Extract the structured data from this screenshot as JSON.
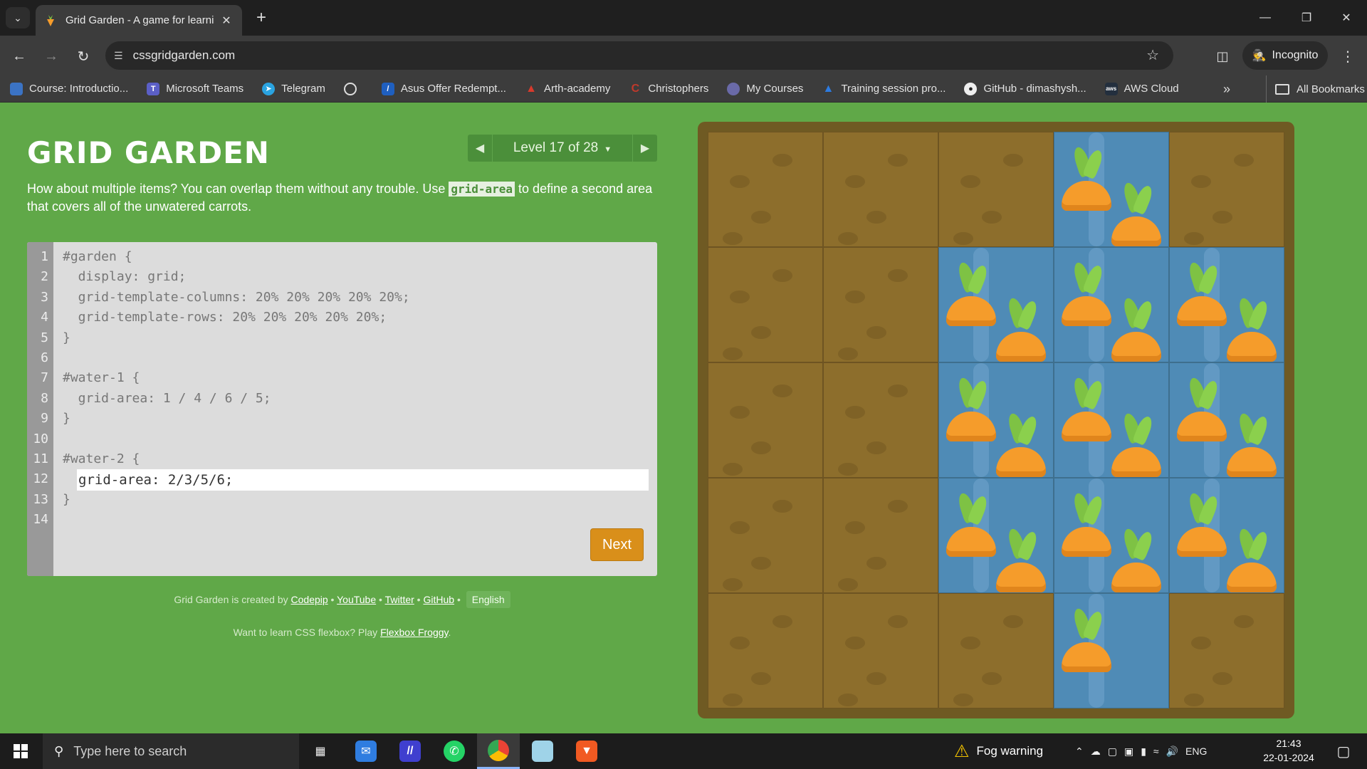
{
  "browser": {
    "tab_title": "Grid Garden - A game for learni",
    "url": "cssgridgarden.com",
    "incognito_label": "Incognito",
    "bookmarks": [
      {
        "label": "Course: Introductio...",
        "color": "#3b73c4"
      },
      {
        "label": "Microsoft Teams",
        "color": "#5b5fc7"
      },
      {
        "label": "Telegram",
        "color": "#2aa3e0"
      },
      {
        "label": "",
        "color": "#555555"
      },
      {
        "label": "Asus Offer Redempt...",
        "color": "#1f5fbf"
      },
      {
        "label": "Arth-academy",
        "color": "#d83a2c"
      },
      {
        "label": "Christophers",
        "color": "#c0392b"
      },
      {
        "label": "My Courses",
        "color": "#6a6aa8"
      },
      {
        "label": "Training session pro...",
        "color": "#2d7be0"
      },
      {
        "label": "GitHub - dimashysh...",
        "color": "#333333"
      },
      {
        "label": "AWS Cloud",
        "color": "#232f3e"
      }
    ],
    "all_bookmarks_label": "All Bookmarks"
  },
  "game": {
    "logo": "GRID GARDEN",
    "level_label": "Level 17 of 28",
    "instructions_before": "How about multiple items? You can overlap them without any trouble. Use ",
    "instructions_code": "grid-area",
    "instructions_after": " to define a second area that covers all of the unwatered carrots.",
    "line_numbers": [
      "1",
      "2",
      "3",
      "4",
      "5",
      "6",
      "7",
      "8",
      "9",
      "10",
      "11",
      "12",
      "13",
      "14"
    ],
    "code_lines": [
      "#garden {",
      "  display: grid;",
      "  grid-template-columns: 20% 20% 20% 20% 20%;",
      "  grid-template-rows: 20% 20% 20% 20% 20%;",
      "}",
      "",
      "#water-1 {",
      "  grid-area: 1 / 4 / 6 / 5;",
      "}",
      "",
      "#water-2 {",
      "",
      "}",
      ""
    ],
    "input_value": "grid-area: 2/3/5/6;",
    "next_label": "Next",
    "credits_prefix": "Grid Garden is created by ",
    "credits_codepip": "Codepip",
    "credits_youtube": "YouTube",
    "credits_twitter": "Twitter",
    "credits_github": "GitHub",
    "language": "English",
    "froggy_prefix": "Want to learn CSS flexbox? Play ",
    "froggy_link": "Flexbox Froggy",
    "froggy_suffix": "."
  },
  "taskbar": {
    "search_placeholder": "Type here to search",
    "weather": "Fog warning",
    "language": "ENG",
    "time": "21:43",
    "date": "22-01-2024"
  },
  "colors": {
    "page_bg": "#60a848",
    "next_button": "#d98f1a",
    "water": "#4f8bb6",
    "soil": "#8d6e2c"
  }
}
